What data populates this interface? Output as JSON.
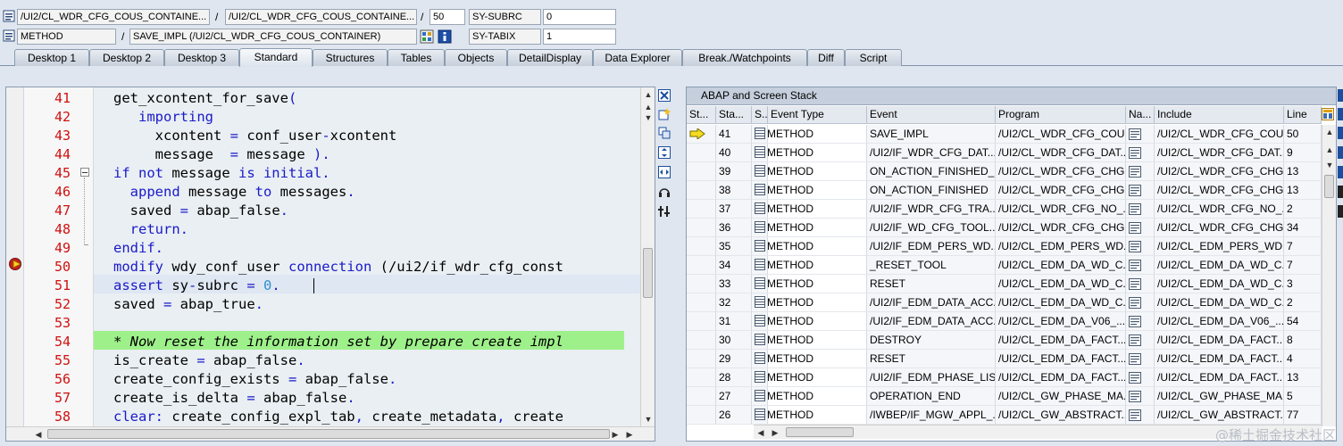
{
  "header": {
    "field1": "/UI2/CL_WDR_CFG_COUS_CONTAINE...",
    "field2": "/UI2/CL_WDR_CFG_COUS_CONTAINE...",
    "line_value": "50",
    "sysvar1_name": "SY-SUBRC",
    "sysvar1_value": "0",
    "event_type": "METHOD",
    "event_name": "SAVE_IMPL (/UI2/CL_WDR_CFG_COUS_CONTAINER)",
    "sysvar2_name": "SY-TABIX",
    "sysvar2_value": "1",
    "separator": "/"
  },
  "tabs": [
    {
      "label": "Desktop 1"
    },
    {
      "label": "Desktop 2"
    },
    {
      "label": "Desktop 3"
    },
    {
      "label": "Standard"
    },
    {
      "label": "Structures"
    },
    {
      "label": "Tables"
    },
    {
      "label": "Objects"
    },
    {
      "label": "DetailDisplay"
    },
    {
      "label": "Data Explorer"
    },
    {
      "label": "Break./Watchpoints"
    },
    {
      "label": "Diff"
    },
    {
      "label": "Script"
    }
  ],
  "editor": {
    "line_numbers": [
      "41",
      "42",
      "43",
      "44",
      "45",
      "46",
      "47",
      "48",
      "49",
      "50",
      "51",
      "52",
      "53",
      "54",
      "55",
      "56",
      "57",
      "58"
    ],
    "lines": [
      [
        {
          "t": "get_xcontent_for_save",
          "c": "op"
        },
        {
          "t": "(",
          "c": "kw"
        }
      ],
      [
        {
          "t": "   importing",
          "c": "kw"
        }
      ],
      [
        {
          "t": "     xcontent ",
          "c": "op"
        },
        {
          "t": "=",
          "c": "kw"
        },
        {
          "t": " conf_user",
          "c": "op"
        },
        {
          "t": "-",
          "c": "kw"
        },
        {
          "t": "xcontent",
          "c": "op"
        }
      ],
      [
        {
          "t": "     message  ",
          "c": "op"
        },
        {
          "t": "=",
          "c": "kw"
        },
        {
          "t": " message ",
          "c": "op"
        },
        {
          "t": ").",
          "c": "kw"
        }
      ],
      [
        {
          "t": "if not ",
          "c": "kw"
        },
        {
          "t": "message ",
          "c": "op"
        },
        {
          "t": "is initial.",
          "c": "kw"
        }
      ],
      [
        {
          "t": "  append ",
          "c": "kw"
        },
        {
          "t": "message ",
          "c": "op"
        },
        {
          "t": "to ",
          "c": "kw"
        },
        {
          "t": "messages",
          "c": "op"
        },
        {
          "t": ".",
          "c": "kw"
        }
      ],
      [
        {
          "t": "  saved ",
          "c": "op"
        },
        {
          "t": "=",
          "c": "kw"
        },
        {
          "t": " abap_false",
          "c": "op"
        },
        {
          "t": ".",
          "c": "kw"
        }
      ],
      [
        {
          "t": "  return.",
          "c": "kw"
        }
      ],
      [
        {
          "t": "endif.",
          "c": "kw"
        }
      ],
      [
        {
          "t": "modify ",
          "c": "kw"
        },
        {
          "t": "wdy_conf_user ",
          "c": "op"
        },
        {
          "t": "connection ",
          "c": "kw"
        },
        {
          "t": "(/ui2/if_wdr_cfg_const",
          "c": "op"
        }
      ],
      [
        {
          "t": "assert ",
          "c": "kw"
        },
        {
          "t": "sy",
          "c": "op"
        },
        {
          "t": "-",
          "c": "kw"
        },
        {
          "t": "subrc ",
          "c": "op"
        },
        {
          "t": "=",
          "c": "kw"
        },
        {
          "t": " ",
          "c": "op"
        },
        {
          "t": "0",
          "c": "num"
        },
        {
          "t": ".",
          "c": "kw"
        }
      ],
      [
        {
          "t": "saved ",
          "c": "op"
        },
        {
          "t": "=",
          "c": "kw"
        },
        {
          "t": " abap_true",
          "c": "op"
        },
        {
          "t": ".",
          "c": "kw"
        }
      ],
      [],
      [
        {
          "t": "* Now reset the information set by prepare create impl",
          "c": "cmt"
        }
      ],
      [
        {
          "t": "is_create ",
          "c": "op"
        },
        {
          "t": "=",
          "c": "kw"
        },
        {
          "t": " abap_false",
          "c": "op"
        },
        {
          "t": ".",
          "c": "kw"
        }
      ],
      [
        {
          "t": "create_config_exists ",
          "c": "op"
        },
        {
          "t": "=",
          "c": "kw"
        },
        {
          "t": " abap_false",
          "c": "op"
        },
        {
          "t": ".",
          "c": "kw"
        }
      ],
      [
        {
          "t": "create_is_delta ",
          "c": "op"
        },
        {
          "t": "=",
          "c": "kw"
        },
        {
          "t": " abap_false",
          "c": "op"
        },
        {
          "t": ".",
          "c": "kw"
        }
      ],
      [
        {
          "t": "clear: ",
          "c": "kw"
        },
        {
          "t": "create_config_expl_tab",
          "c": "op"
        },
        {
          "t": ", ",
          "c": "kw"
        },
        {
          "t": "create_metadata",
          "c": "op"
        },
        {
          "t": ", ",
          "c": "kw"
        },
        {
          "t": "create",
          "c": "op"
        }
      ]
    ]
  },
  "stack": {
    "title": "ABAP and Screen Stack",
    "columns": [
      "St...",
      "Sta...",
      "S...",
      "Event Type",
      "Event",
      "Program",
      "Na...",
      "Include",
      "Line"
    ],
    "rows": [
      {
        "level": "41",
        "type": "METHOD",
        "event": "SAVE_IMPL",
        "program": "/UI2/CL_WDR_CFG_COU...",
        "include": "/UI2/CL_WDR_CFG_COU...",
        "line": "50"
      },
      {
        "level": "40",
        "type": "METHOD",
        "event": "/UI2/IF_WDR_CFG_DAT...",
        "program": "/UI2/CL_WDR_CFG_DAT...",
        "include": "/UI2/CL_WDR_CFG_DAT...",
        "line": "9"
      },
      {
        "level": "39",
        "type": "METHOD",
        "event": "ON_ACTION_FINISHED_...",
        "program": "/UI2/CL_WDR_CFG_CHG...",
        "include": "/UI2/CL_WDR_CFG_CHG...",
        "line": "13"
      },
      {
        "level": "38",
        "type": "METHOD",
        "event": "ON_ACTION_FINISHED",
        "program": "/UI2/CL_WDR_CFG_CHG...",
        "include": "/UI2/CL_WDR_CFG_CHG...",
        "line": "13"
      },
      {
        "level": "37",
        "type": "METHOD",
        "event": "/UI2/IF_WDR_CFG_TRA...",
        "program": "/UI2/CL_WDR_CFG_NO_...",
        "include": "/UI2/CL_WDR_CFG_NO_...",
        "line": "2"
      },
      {
        "level": "36",
        "type": "METHOD",
        "event": "/UI2/IF_WD_CFG_TOOL...",
        "program": "/UI2/CL_WDR_CFG_CHG...",
        "include": "/UI2/CL_WDR_CFG_CHG...",
        "line": "34"
      },
      {
        "level": "35",
        "type": "METHOD",
        "event": "/UI2/IF_EDM_PERS_WD...",
        "program": "/UI2/CL_EDM_PERS_WD...",
        "include": "/UI2/CL_EDM_PERS_WD...",
        "line": "7"
      },
      {
        "level": "34",
        "type": "METHOD",
        "event": "_RESET_TOOL",
        "program": "/UI2/CL_EDM_DA_WD_C...",
        "include": "/UI2/CL_EDM_DA_WD_C...",
        "line": "7"
      },
      {
        "level": "33",
        "type": "METHOD",
        "event": "RESET",
        "program": "/UI2/CL_EDM_DA_WD_C...",
        "include": "/UI2/CL_EDM_DA_WD_C...",
        "line": "3"
      },
      {
        "level": "32",
        "type": "METHOD",
        "event": "/UI2/IF_EDM_DATA_ACC...",
        "program": "/UI2/CL_EDM_DA_WD_C...",
        "include": "/UI2/CL_EDM_DA_WD_C...",
        "line": "2"
      },
      {
        "level": "31",
        "type": "METHOD",
        "event": "/UI2/IF_EDM_DATA_ACC...",
        "program": "/UI2/CL_EDM_DA_V06_...",
        "include": "/UI2/CL_EDM_DA_V06_...",
        "line": "54"
      },
      {
        "level": "30",
        "type": "METHOD",
        "event": "DESTROY",
        "program": "/UI2/CL_EDM_DA_FACT...",
        "include": "/UI2/CL_EDM_DA_FACT...",
        "line": "8"
      },
      {
        "level": "29",
        "type": "METHOD",
        "event": "RESET",
        "program": "/UI2/CL_EDM_DA_FACT...",
        "include": "/UI2/CL_EDM_DA_FACT...",
        "line": "4"
      },
      {
        "level": "28",
        "type": "METHOD",
        "event": "/UI2/IF_EDM_PHASE_LIS...",
        "program": "/UI2/CL_EDM_DA_FACT...",
        "include": "/UI2/CL_EDM_DA_FACT...",
        "line": "13"
      },
      {
        "level": "27",
        "type": "METHOD",
        "event": "OPERATION_END",
        "program": "/UI2/CL_GW_PHASE_MA...",
        "include": "/UI2/CL_GW_PHASE_MA...",
        "line": "5"
      },
      {
        "level": "26",
        "type": "METHOD",
        "event": "/IWBEP/IF_MGW_APPL_...",
        "program": "/UI2/CL_GW_ABSTRACT...",
        "include": "/UI2/CL_GW_ABSTRACT...",
        "line": "77"
      }
    ]
  },
  "watermark": "@稀土掘金技术社区"
}
